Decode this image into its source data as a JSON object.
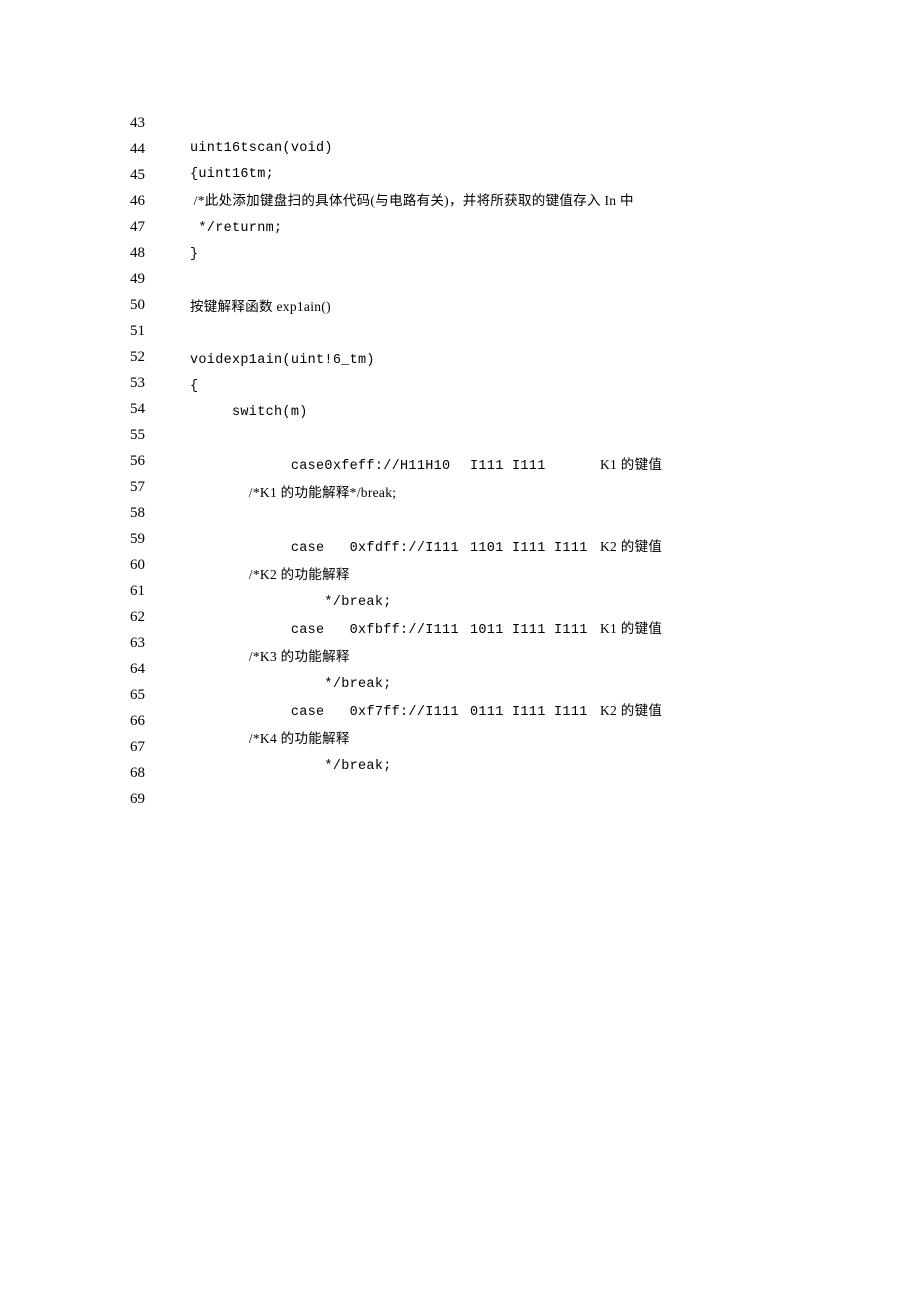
{
  "gutter": [
    "43",
    "44",
    "45",
    "46",
    "47",
    "48",
    "49",
    "50",
    "51",
    "52",
    "53",
    "54",
    "55",
    "56",
    "57",
    "58",
    "59",
    "60",
    "61",
    "62",
    "63",
    "64",
    "65",
    "66",
    "67",
    "68",
    "69"
  ],
  "lines": {
    "l43": "uint16tscan(void)",
    "l44": "{uint16tm;",
    "l45": " /*此处添加键盘扫的具体代码(与电路有关)，并将所获取的键值存入 In 中",
    "l46": " */returnm;",
    "l47": "}",
    "l48": "",
    "l49": "按键解释函数 exp1ain()",
    "l50": "",
    "l51": "voidexp1ain(uint!6_tm)",
    "l52": "{",
    "l53": "     switch(m)",
    "l54": "",
    "l55a": "            case0xfeff://H11H10",
    "l55b": "I111 I111",
    "l55c": "K1 的键值",
    "l56": "                /*K1 的功能解释*/break;",
    "l57": "",
    "l58a": "            case   0xfdff://I111",
    "l58b": "1101 I111 I111",
    "l58c": "K2 的键值",
    "l59": "                /*K2 的功能解释",
    "l60": "                */break;",
    "l61a": "            case   0xfbff://I111",
    "l61b": "1011 I111 I111",
    "l61c": "K1 的键值",
    "l62": "                /*K3 的功能解释",
    "l63": "                */break;",
    "l64a": "            case   0xf7ff://I111",
    "l64b": "0111 I111 I111",
    "l64c": "K2 的键值",
    "l65": "                /*K4 的功能解释",
    "l66": "                */break;"
  }
}
